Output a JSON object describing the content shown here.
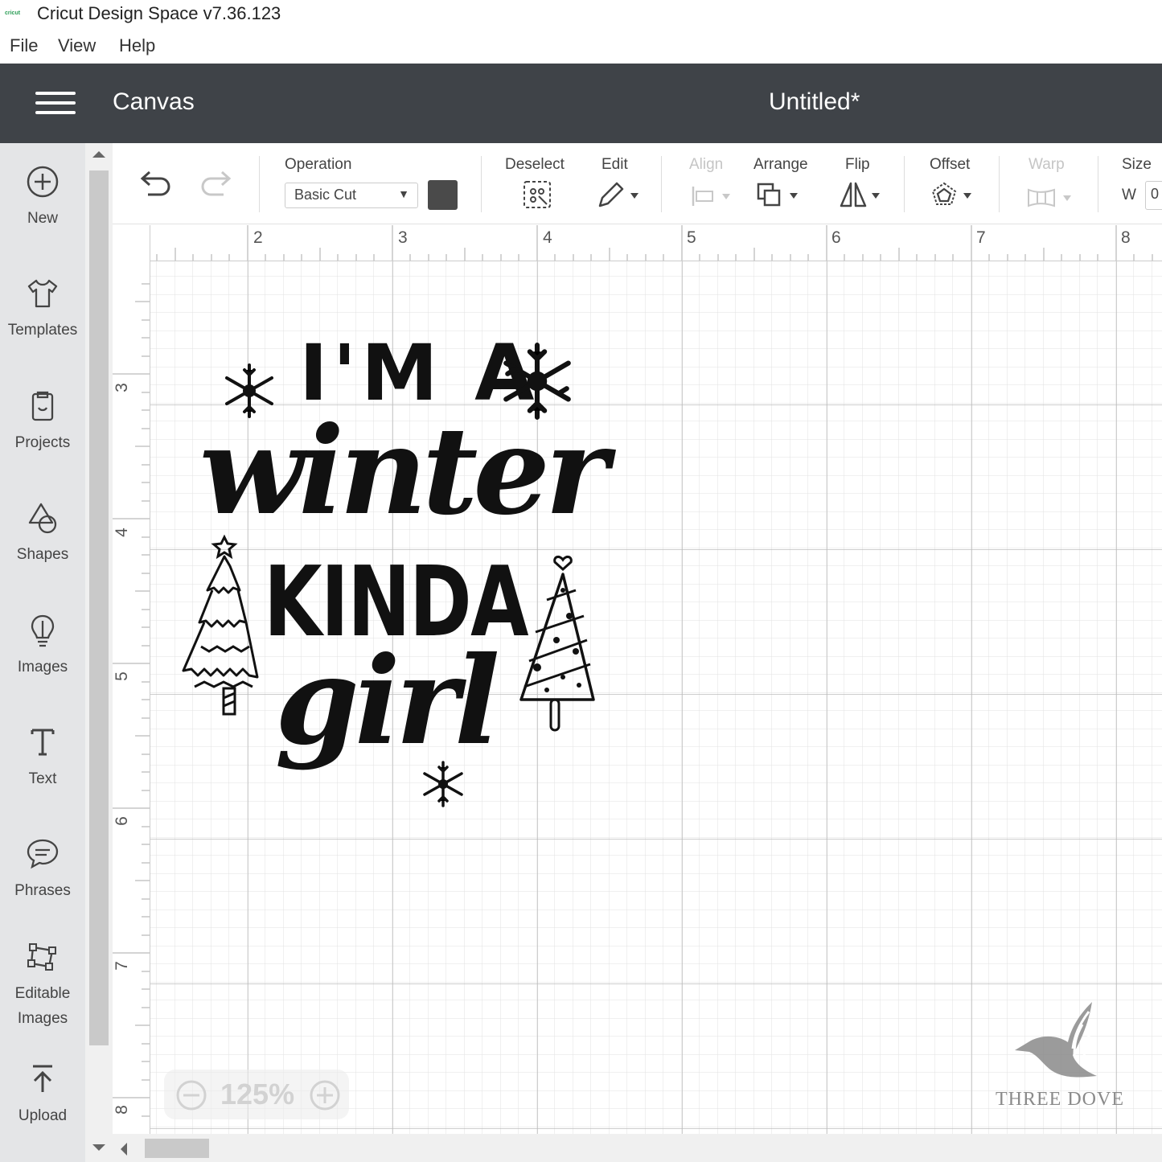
{
  "window": {
    "logo_text": "cricut",
    "title": "Cricut Design Space  v7.36.123"
  },
  "menu": [
    "File",
    "View",
    "Help"
  ],
  "header": {
    "section": "Canvas",
    "project_title": "Untitled*"
  },
  "nav": [
    {
      "label": "New",
      "icon": "plus-circle-icon"
    },
    {
      "label": "Templates",
      "icon": "tshirt-icon"
    },
    {
      "label": "Projects",
      "icon": "projects-icon"
    },
    {
      "label": "Shapes",
      "icon": "shapes-icon"
    },
    {
      "label": "Images",
      "icon": "lightbulb-icon"
    },
    {
      "label": "Text",
      "icon": "text-icon"
    },
    {
      "label": "Phrases",
      "icon": "speech-bubble-icon"
    },
    {
      "label": "Editable Images",
      "icon": "editable-image-icon"
    },
    {
      "label": "Upload",
      "icon": "upload-icon"
    }
  ],
  "toolbar": {
    "operation_label": "Operation",
    "operation_value": "Basic Cut",
    "operation_color": "#4a4a4a",
    "deselect_label": "Deselect",
    "edit_label": "Edit",
    "align_label": "Align",
    "arrange_label": "Arrange",
    "flip_label": "Flip",
    "offset_label": "Offset",
    "warp_label": "Warp",
    "size_label": "Size",
    "size_w_label": "W",
    "size_w_value": "0"
  },
  "ruler": {
    "top": [
      "2",
      "2",
      "3",
      "4",
      "5",
      "6",
      "7",
      "8"
    ],
    "left": [
      "3",
      "4",
      "5",
      "6",
      "7",
      "8"
    ]
  },
  "zoom": {
    "value": "125%"
  },
  "design": {
    "line1": "I'M A",
    "line2": "winter",
    "line3": "KINDA",
    "line4": "girl"
  },
  "watermark": "THREE DOVE",
  "colors": {
    "header_bg": "#3f4348",
    "nav_bg": "#e4e5e7"
  }
}
